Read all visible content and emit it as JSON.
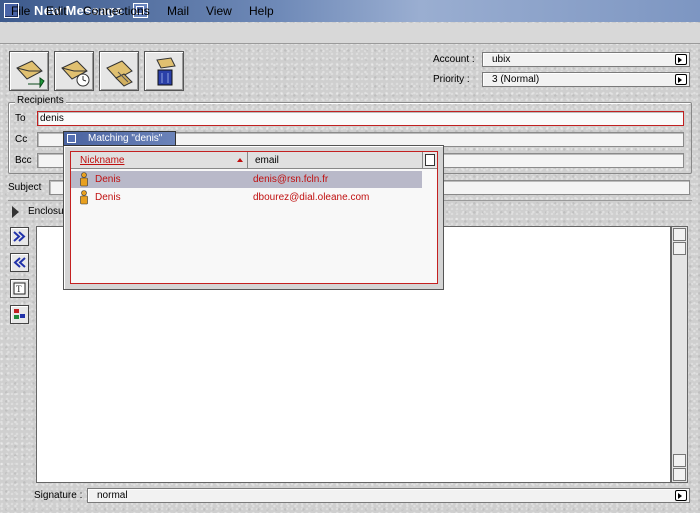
{
  "window": {
    "title": "New Message"
  },
  "menu": [
    "File",
    "Edit",
    "Connections",
    "Mail",
    "View",
    "Help"
  ],
  "toolbar": {
    "buttons": [
      {
        "name": "send-icon"
      },
      {
        "name": "send-later-icon"
      },
      {
        "name": "attach-icon"
      },
      {
        "name": "trash-icon"
      }
    ]
  },
  "account": {
    "label": "Account :",
    "value": "ubix"
  },
  "priority": {
    "label": "Priority :",
    "value": "3 (Normal)"
  },
  "recipients": {
    "group_label": "Recipients",
    "to_label": "To",
    "to_value": "denis",
    "cc_label": "Cc",
    "bcc_label": "Bcc"
  },
  "subject": {
    "label": "Subject"
  },
  "enclosures": {
    "label": "Enclosu"
  },
  "signature": {
    "label": "Signature :",
    "value": "normal"
  },
  "matching": {
    "title": "Matching \"denis\"",
    "columns": {
      "nickname": "Nickname",
      "email": "email"
    },
    "rows": [
      {
        "nickname": "Denis",
        "email": "denis@rsn.fcln.fr",
        "selected": true
      },
      {
        "nickname": "Denis",
        "email": "dbourez@dial.oleane.com",
        "selected": false
      }
    ]
  },
  "colors": {
    "accent_red": "#c01010",
    "title_blue": "#4964a6",
    "selection": "#b9b9c9"
  }
}
